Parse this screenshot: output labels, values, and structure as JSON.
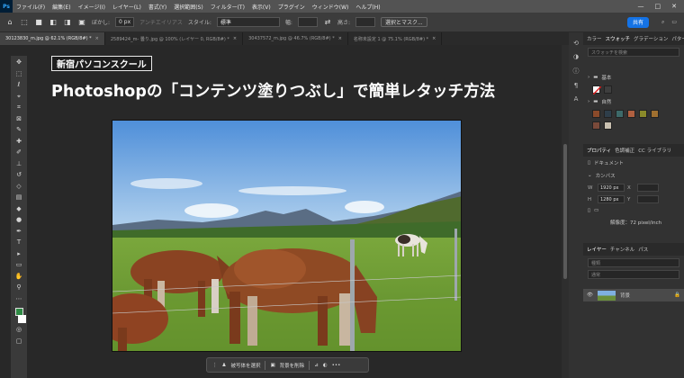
{
  "app": {
    "logo": "Ps"
  },
  "menu": [
    "ファイル(F)",
    "編集(E)",
    "イメージ(I)",
    "レイヤー(L)",
    "書式(Y)",
    "選択範囲(S)",
    "フィルター(T)",
    "表示(V)",
    "プラグイン",
    "ウィンドウ(W)",
    "ヘルプ(H)"
  ],
  "window_controls": [
    "—",
    "□",
    "✕"
  ],
  "options": {
    "feather_label": "ぼかし:",
    "feather_value": "0 px",
    "antialias_label": "アンチエイリアス",
    "style_label": "スタイル:",
    "style_value": "標準",
    "width_label": "幅:",
    "height_label": "高さ:",
    "mask_button": "選択とマスク...",
    "share_button": "共有"
  },
  "tabs": [
    {
      "label": "30123830_m.jpg @ 62.1% (RGB/8#) *",
      "active": true
    },
    {
      "label": "2589424_m- 曇り.jpg @ 100% (レイヤー 0, RGB/8#) *",
      "active": false
    },
    {
      "label": "30437572_m.jpg @ 46.7% (RGB/8#) *",
      "active": false
    },
    {
      "label": "名称未設定 1 @ 75.1% (RGB/8#) *",
      "active": false
    }
  ],
  "overlay": {
    "badge": "新宿パソコンスクール",
    "headline": "Photoshopの「コンテンツ塗りつぶし」で簡単レタッチ方法"
  },
  "context_bar": {
    "select_subject": "被写体を選択",
    "remove_bg": "背景を削除",
    "more": "•••"
  },
  "panels": {
    "top_tabs": [
      "カラー",
      "スウォッチ",
      "グラデーション",
      "パターン"
    ],
    "swatch_search": "スウォッチを検索",
    "group_basic": "基本",
    "group_nature": "自然",
    "prop_tabs": [
      "プロパティ",
      "色調補正",
      "CC ライブラリ"
    ],
    "doc_label": "ドキュメント",
    "canvas_label": "カンバス",
    "w_label": "W",
    "w_value": "1920 px",
    "h_label": "H",
    "h_value": "1280 px",
    "x_label": "X",
    "y_label": "Y",
    "resolution": "解像度：72 pixel/inch",
    "layer_tabs": [
      "レイヤー",
      "チャンネル",
      "パス"
    ],
    "layer_search": "種類",
    "layer_mode": "通常",
    "layer_name": "背景"
  },
  "colors": {
    "accent": "#31a8ff",
    "share": "#1473e6",
    "foreground": "#2e8a44"
  },
  "icons": [
    "home-icon",
    "marquee-icon",
    "move-icon",
    "lasso-icon",
    "crop-icon",
    "eyedropper-icon",
    "brush-icon",
    "stamp-icon",
    "eraser-icon",
    "gradient-icon",
    "pen-icon",
    "type-icon",
    "hand-icon",
    "zoom-icon"
  ]
}
